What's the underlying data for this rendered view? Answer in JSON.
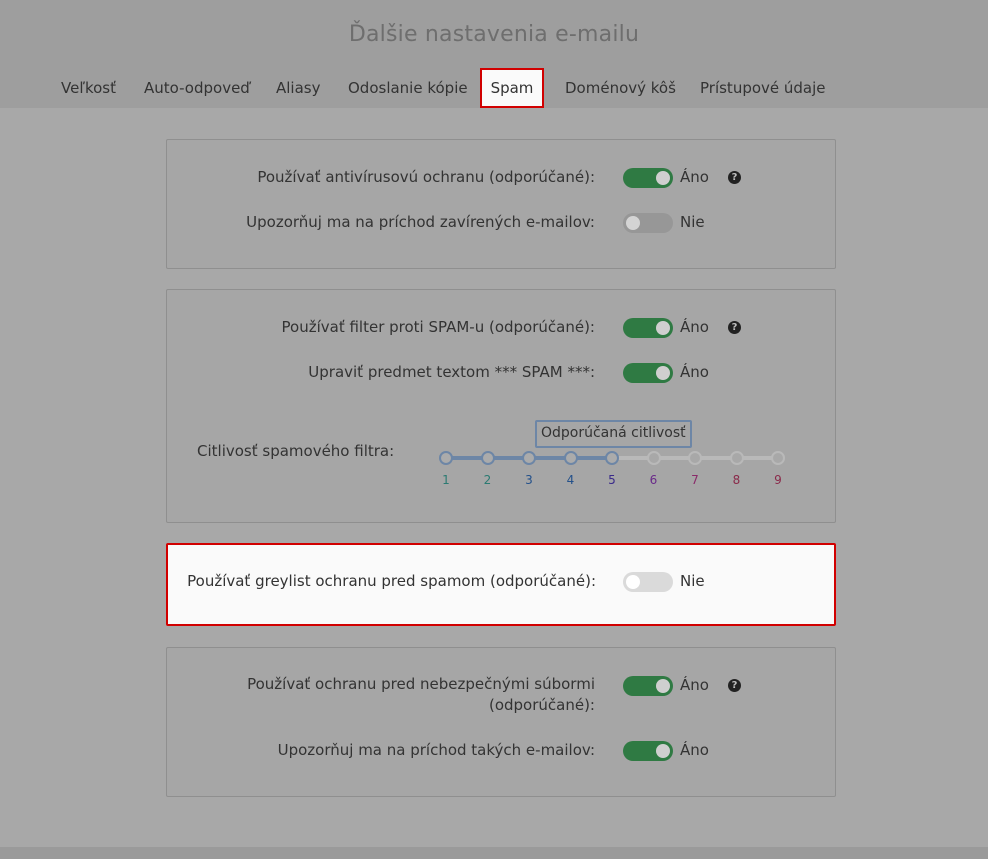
{
  "title": "Ďalšie nastavenia e-mailu",
  "tabs": [
    "Veľkosť",
    "Auto-odpoveď",
    "Aliasy",
    "Odoslanie kópie",
    "Spam",
    "Doménový kôš",
    "Prístupové údaje"
  ],
  "active_tab": "Spam",
  "help_icon": "question-circle-icon",
  "colors": {
    "toggle_on": "#2f7a43",
    "highlight_border": "#d10000",
    "slider_accent": "#6d86a6"
  },
  "antivirus": {
    "use_label": "Používať antivírusovú ochranu (odporúčané):",
    "use_state": "Áno",
    "notify_label": "Upozorňuj ma na príchod zavírených e-mailov:",
    "notify_state": "Nie"
  },
  "spam": {
    "filter_label": "Používať filter proti SPAM-u (odporúčané):",
    "filter_state": "Áno",
    "subject_label": "Upraviť predmet textom *** SPAM ***:",
    "subject_state": "Áno",
    "sensitivity_label": "Citlivosť spamového filtra:",
    "sensitivity_tooltip": "Odporúčaná citlivosť",
    "sensitivity_value": 5,
    "ticks": [
      "1",
      "2",
      "3",
      "4",
      "5",
      "6",
      "7",
      "8",
      "9"
    ],
    "tick_colors": [
      "#2b7a72",
      "#2b7a72",
      "#23508a",
      "#23508a",
      "#3a2a8a",
      "#6a2a8a",
      "#8a2a6a",
      "#8a2a4a",
      "#8a2a4a"
    ]
  },
  "greylist": {
    "label": "Používať greylist ochranu pred spamom (odporúčané):",
    "state": "Nie"
  },
  "dangerous": {
    "use_label": "Používať ochranu pred nebezpečnými súbormi (odporúčané):",
    "use_state": "Áno",
    "notify_label": "Upozorňuj ma na príchod takých e-mailov:",
    "notify_state": "Áno"
  }
}
